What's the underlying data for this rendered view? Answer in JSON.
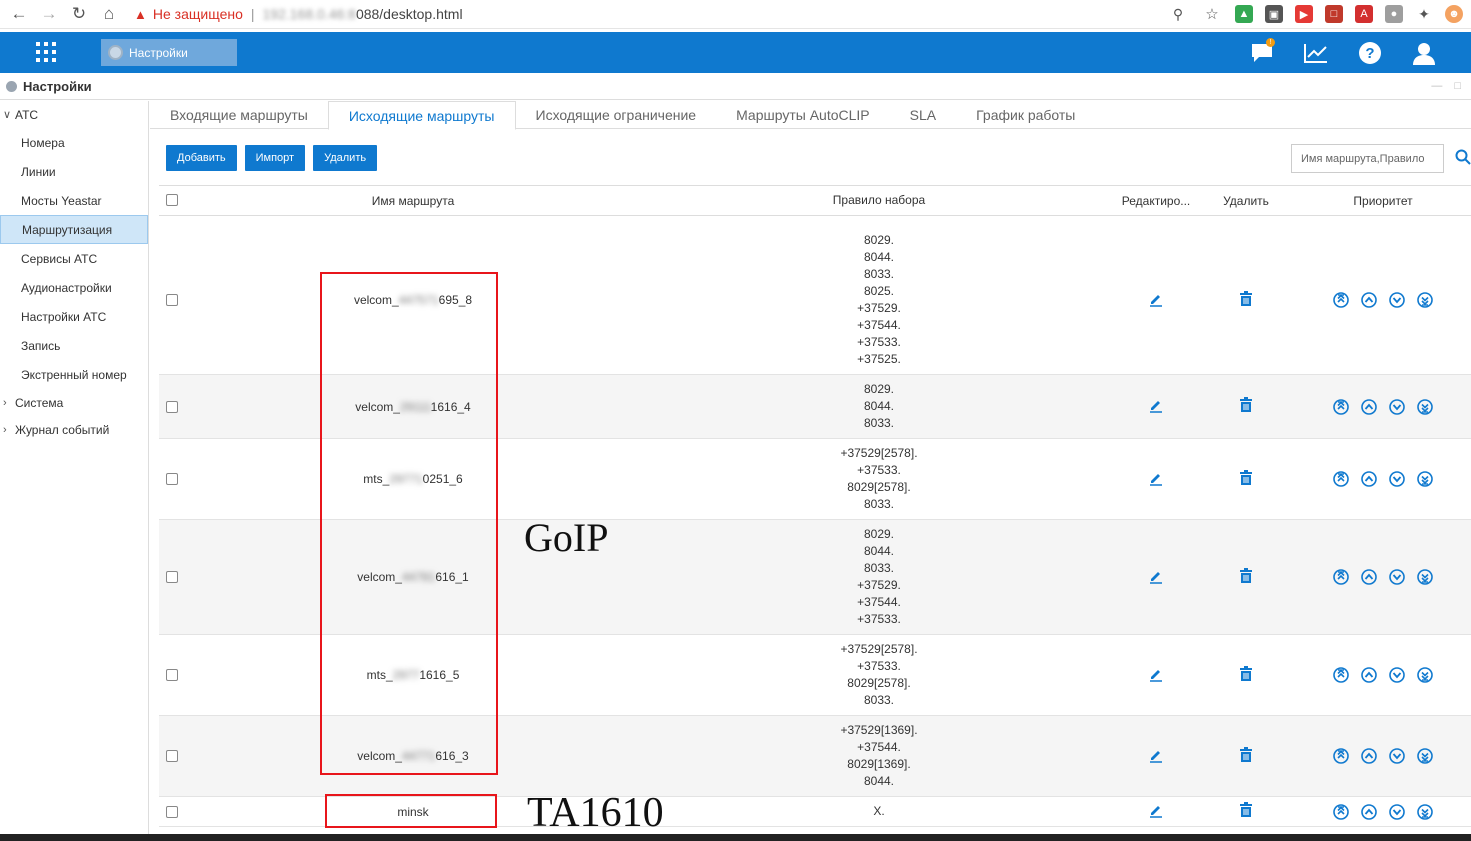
{
  "browser": {
    "warning": "Не защищено",
    "url_host": "192.168.0.46:8",
    "url_rest": "088/desktop.html"
  },
  "app": {
    "tab_label": "Настройки",
    "title": "Настройки"
  },
  "sidebar": {
    "groups": [
      {
        "label": "АТС",
        "expanded": true
      },
      {
        "label": "Система",
        "expanded": false
      },
      {
        "label": "Журнал событий",
        "expanded": false
      }
    ],
    "items": [
      "Номера",
      "Линии",
      "Мосты Yeastar",
      "Маршрутизация",
      "Сервисы АТС",
      "Аудионастройки",
      "Настройки АТС",
      "Запись",
      "Экстренный номер"
    ],
    "active_item": "Маршрутизация"
  },
  "tabs": [
    "Входящие маршруты",
    "Исходящие маршруты",
    "Исходящие ограничение",
    "Маршруты AutoCLIP",
    "SLA",
    "График работы"
  ],
  "active_tab": "Исходящие маршруты",
  "toolbar": {
    "add": "Добавить",
    "import": "Импорт",
    "delete": "Удалить"
  },
  "search": {
    "placeholder": "Имя маршрута,Правило"
  },
  "table": {
    "headers": {
      "name": "Имя маршрута",
      "rule": "Правило набора",
      "edit": "Редактиро...",
      "delete": "Удалить",
      "priority": "Приоритет"
    },
    "rows": [
      {
        "name_prefix": "velcom_",
        "name_hidden": "447571",
        "name_suffix": "695_8",
        "rules": [
          "8029.",
          "8044.",
          "8033.",
          "8025.",
          "+37529.",
          "+37544.",
          "+37533.",
          "+37525."
        ]
      },
      {
        "name_prefix": "velcom_",
        "name_hidden": "29111",
        "name_suffix": "1616_4",
        "rules": [
          "8029.",
          "8044.",
          "8033."
        ]
      },
      {
        "name_prefix": "mts_",
        "name_hidden": "29771",
        "name_suffix": "0251_6",
        "rules": [
          "+37529[2578].",
          "+37533.",
          "8029[2578].",
          "8033."
        ]
      },
      {
        "name_prefix": "velcom_",
        "name_hidden": "44781",
        "name_suffix": "616_1",
        "rules": [
          "8029.",
          "8044.",
          "8033.",
          "+37529.",
          "+37544.",
          "+37533."
        ]
      },
      {
        "name_prefix": "mts_",
        "name_hidden": "2977",
        "name_suffix": "1616_5",
        "rules": [
          "+37529[2578].",
          "+37533.",
          "8029[2578].",
          "8033."
        ]
      },
      {
        "name_prefix": "velcom_",
        "name_hidden": "44771",
        "name_suffix": "616_3",
        "rules": [
          "+37529[1369].",
          "+37544.",
          "8029[1369].",
          "8044."
        ]
      },
      {
        "name_prefix": "minsk",
        "name_hidden": "",
        "name_suffix": "",
        "rules": [
          "X."
        ]
      }
    ]
  },
  "annotations": {
    "goip": "GoIP",
    "ta": "TA1610"
  },
  "colors": {
    "brand": "#0f79cf",
    "annotation": "#e8151b"
  }
}
